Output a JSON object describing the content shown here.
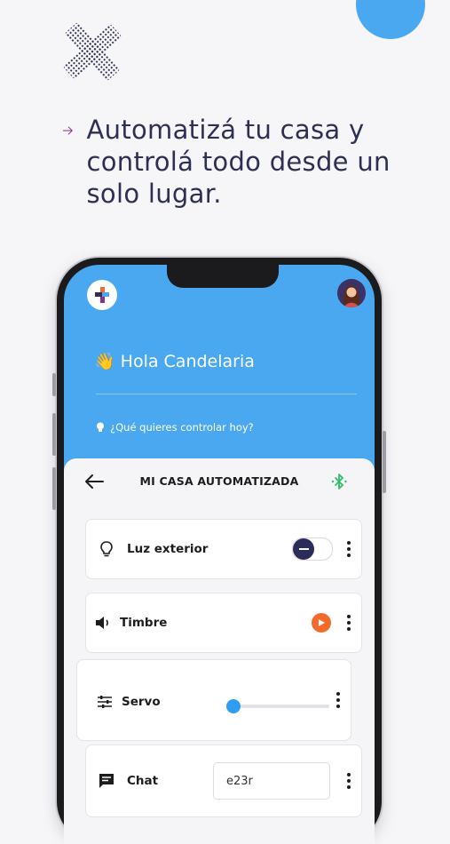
{
  "headline": "Automatizá tu casa y controlá todo desde un solo lugar.",
  "colors": {
    "accent_blue": "#4aa8f0",
    "arrow_purple": "#8a2f8f",
    "headline_text": "#2f2f55",
    "play_orange": "#f26a2c",
    "toggle_knob": "#2c2c5a",
    "bluetooth_green": "#2fbf6a"
  },
  "app": {
    "greeting_emoji": "👋",
    "greeting": "Hola Candelaria",
    "question": "¿Qué quieres controlar hoy?",
    "panel_title": "MI CASA AUTOMATIZADA",
    "icons": {
      "logo": "app-logo-icon",
      "avatar": "user-avatar",
      "back": "arrow-left-icon",
      "bluetooth": "bluetooth-icon",
      "question": "lightbulb-icon"
    }
  },
  "devices": [
    {
      "label": "Luz exterior",
      "icon": "lightbulb-icon",
      "control": "toggle",
      "state": "off"
    },
    {
      "label": "Timbre",
      "icon": "speaker-icon",
      "control": "play"
    },
    {
      "label": "Servo",
      "icon": "sliders-icon",
      "control": "slider",
      "value": 0
    },
    {
      "label": "Chat",
      "icon": "chat-icon",
      "control": "input",
      "input_value": "e23r"
    }
  ]
}
